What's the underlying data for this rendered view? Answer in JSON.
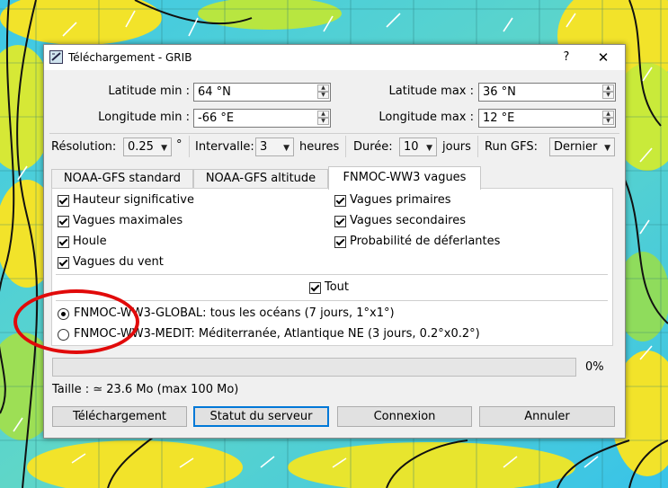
{
  "window": {
    "title": "Téléchargement - GRIB",
    "help_label": "?",
    "close_label": "✕"
  },
  "bounds": {
    "lat_min_label": "Latitude min :",
    "lat_min_value": "64 °N",
    "lat_max_label": "Latitude max :",
    "lat_max_value": "36 °N",
    "lon_min_label": "Longitude min :",
    "lon_min_value": "-66 °E",
    "lon_max_label": "Longitude max :",
    "lon_max_value": "12 °E"
  },
  "params": {
    "resolution_label": "Résolution:",
    "resolution_value": "0.25",
    "resolution_unit": "°",
    "interval_label": "Intervalle:",
    "interval_value": "3",
    "interval_unit": "heures",
    "duration_label": "Durée:",
    "duration_value": "10",
    "duration_unit": "jours",
    "run_label": "Run GFS:",
    "run_value": "Dernier"
  },
  "tabs": [
    {
      "label": "NOAA-GFS standard",
      "active": false
    },
    {
      "label": "NOAA-GFS altitude",
      "active": false
    },
    {
      "label": "FNMOC-WW3 vagues",
      "active": true
    }
  ],
  "options": {
    "left": [
      {
        "label": "Hauteur significative",
        "checked": true
      },
      {
        "label": "Vagues maximales",
        "checked": true
      },
      {
        "label": "Houle",
        "checked": true
      },
      {
        "label": "Vagues du vent",
        "checked": true
      }
    ],
    "right": [
      {
        "label": "Vagues primaires",
        "checked": true
      },
      {
        "label": "Vagues secondaires",
        "checked": true
      },
      {
        "label": "Probabilité de déferlantes",
        "checked": true
      }
    ],
    "all_label": "Tout"
  },
  "models": [
    {
      "label": "FNMOC-WW3-GLOBAL: tous les océans (7 jours, 1°x1°)",
      "selected": true
    },
    {
      "label": "FNMOC-WW3-MEDIT: Méditerranée, Atlantique NE (3 jours, 0.2°x0.2°)",
      "selected": false
    }
  ],
  "progress": {
    "value": 0,
    "label": "0%"
  },
  "size_text": "Taille : ≃ 23.6 Mo (max 100 Mo)",
  "buttons": {
    "download": "Téléchargement",
    "server_status": "Statut du serveur",
    "connect": "Connexion",
    "cancel": "Annuler"
  },
  "colors": {
    "accent": "#0078d7",
    "progress": "#06b025",
    "annotation": "#e10a0a"
  }
}
